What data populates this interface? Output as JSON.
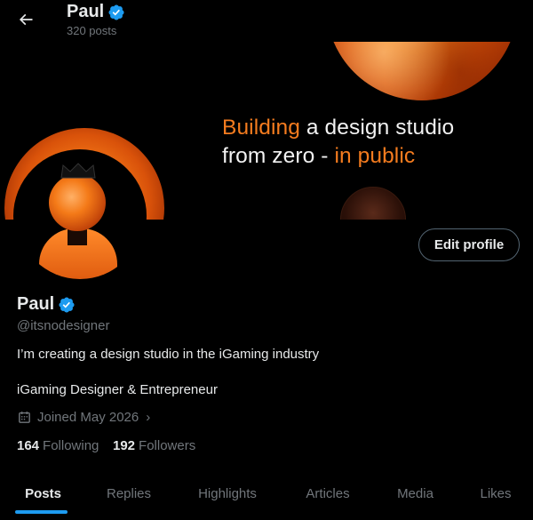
{
  "header": {
    "title": "Paul",
    "posts_count": "320 posts"
  },
  "banner": {
    "line1_accent": "Building",
    "line1_rest": " a design studio",
    "line2_rest": "from zero - ",
    "line2_accent": "in public",
    "accent_color": "#f57c1f"
  },
  "profile": {
    "edit_label": "Edit profile",
    "name": "Paul",
    "handle": "@itsnodesigner",
    "bio": "I’m creating a design studio in the iGaming industry",
    "subtitle": "iGaming Designer & Entrepreneur",
    "joined": "Joined May 2026",
    "following_count": "164",
    "following_label": "Following",
    "followers_count": "192",
    "followers_label": "Followers",
    "verified_color": "#1d9bf0"
  },
  "tabs": [
    {
      "label": "Posts",
      "active": true
    },
    {
      "label": "Replies",
      "active": false
    },
    {
      "label": "Highlights",
      "active": false
    },
    {
      "label": "Articles",
      "active": false
    },
    {
      "label": "Media",
      "active": false
    },
    {
      "label": "Likes",
      "active": false
    }
  ]
}
